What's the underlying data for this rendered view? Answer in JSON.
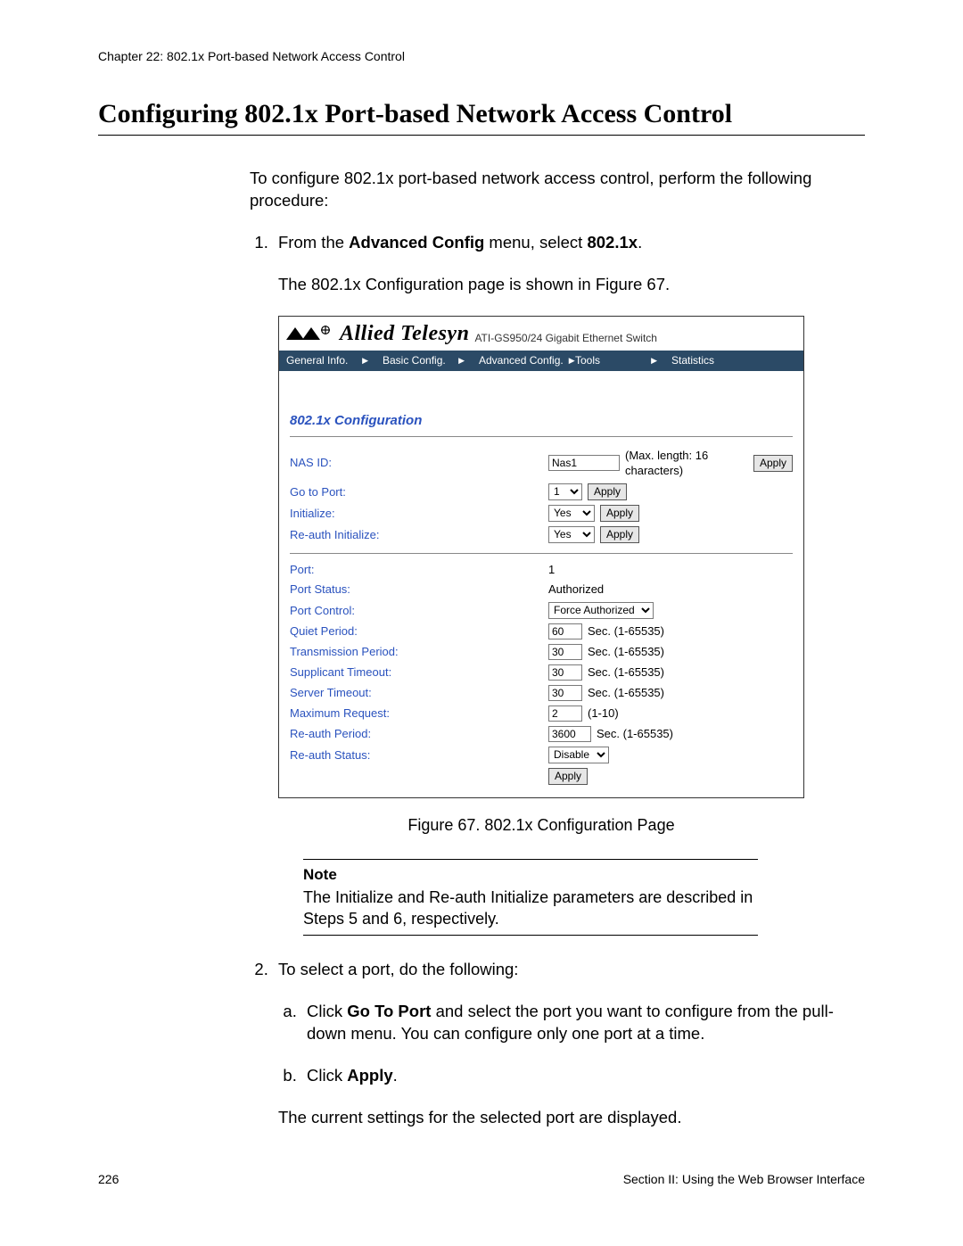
{
  "chapter_header": "Chapter 22: 802.1x Port-based Network Access Control",
  "section_title": "Configuring 802.1x Port-based Network Access Control",
  "intro": "To configure 802.1x port-based network access control, perform the following procedure:",
  "step1_prefix": "From the ",
  "step1_menu": "Advanced Config",
  "step1_mid": " menu, select ",
  "step1_target": "802.1x",
  "step1_suffix": ".",
  "step1_result": "The 802.1x Configuration page is shown in Figure 67.",
  "figure_caption": "Figure 67. 802.1x Configuration Page",
  "note_label": "Note",
  "note_body": "The Initialize and Re-auth Initialize parameters are described in Steps 5 and 6, respectively.",
  "step2_intro": "To select a port, do the following:",
  "step2a_prefix": "Click ",
  "step2a_bold": "Go To Port",
  "step2a_rest": " and select the port you want to configure from the pull-down menu. You can configure only one port at a time.",
  "step2b_prefix": "Click ",
  "step2b_bold": "Apply",
  "step2b_suffix": ".",
  "step2_result": "The current settings for the selected port are displayed.",
  "page_number": "226",
  "section_footer": "Section II: Using the Web Browser Interface",
  "fig": {
    "brand": "Allied Telesyn",
    "model": "ATI-GS950/24 Gigabit Ethernet Switch",
    "menu": {
      "general": "General Info.",
      "basic": "Basic Config.",
      "advanced": "Advanced Config.",
      "tools": "Tools",
      "stats": "Statistics"
    },
    "panel_title": "802.1x Configuration",
    "labels": {
      "nas_id": "NAS ID:",
      "goto_port": "Go to Port:",
      "initialize": "Initialize:",
      "reauth_init": "Re-auth Initialize:",
      "port": "Port:",
      "port_status": "Port Status:",
      "port_control": "Port Control:",
      "quiet_period": "Quiet Period:",
      "tx_period": "Transmission Period:",
      "supp_timeout": "Supplicant Timeout:",
      "server_timeout": "Server Timeout:",
      "max_req": "Maximum Request:",
      "reauth_period": "Re-auth Period:",
      "reauth_status": "Re-auth Status:"
    },
    "values": {
      "nas_id": "Nas1",
      "nas_hint": "(Max. length: 16 characters)",
      "goto_port": "1",
      "initialize": "Yes",
      "reauth_init": "Yes",
      "port": "1",
      "port_status": "Authorized",
      "port_control": "Force Authorized",
      "quiet_period": "60",
      "tx_period": "30",
      "supp_timeout": "30",
      "server_timeout": "30",
      "max_req": "2",
      "reauth_period": "3600",
      "reauth_status": "Disable",
      "sec_hint": "Sec. (1-65535)",
      "maxreq_hint": "(1-10)"
    },
    "btn_apply": "Apply"
  }
}
